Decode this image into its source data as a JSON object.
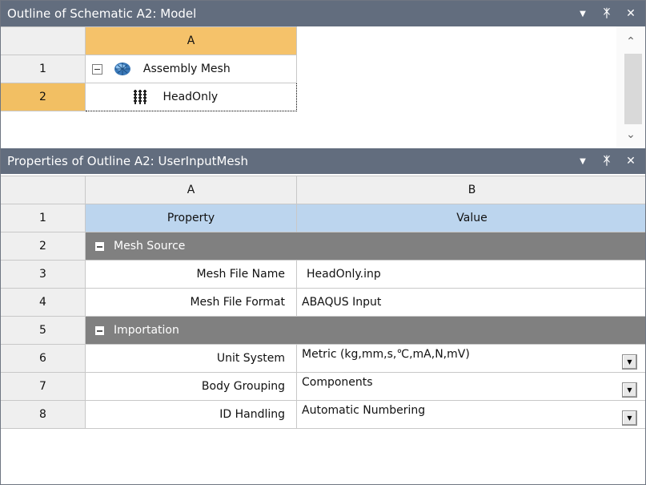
{
  "outline": {
    "title": "Outline of Schematic A2: Model",
    "col_header": "A",
    "rows": [
      {
        "num": "1",
        "label": "Assembly Mesh"
      },
      {
        "num": "2",
        "label": "HeadOnly"
      }
    ]
  },
  "properties": {
    "title": "Properties of Outline A2: UserInputMesh",
    "col_a": "A",
    "col_b": "B",
    "rows": [
      {
        "num": "1",
        "property": "Property",
        "value": "Value"
      },
      {
        "num": "2",
        "group": "Mesh Source"
      },
      {
        "num": "3",
        "property": "Mesh File Name",
        "value": "HeadOnly.inp"
      },
      {
        "num": "4",
        "property": "Mesh File Format",
        "value": "ABAQUS Input"
      },
      {
        "num": "5",
        "group": "Importation"
      },
      {
        "num": "6",
        "property": "Unit System",
        "value": "Metric (kg,mm,s,℃,mA,N,mV)"
      },
      {
        "num": "7",
        "property": "Body Grouping",
        "value": "Components"
      },
      {
        "num": "8",
        "property": "ID Handling",
        "value": "Automatic Numbering"
      }
    ]
  },
  "icons": {
    "dropdown": "dropdown-arrow-icon",
    "pin": "pin-icon",
    "close": "close-icon",
    "assembly": "assembly-mesh-icon",
    "mesh": "mesh-icon"
  }
}
